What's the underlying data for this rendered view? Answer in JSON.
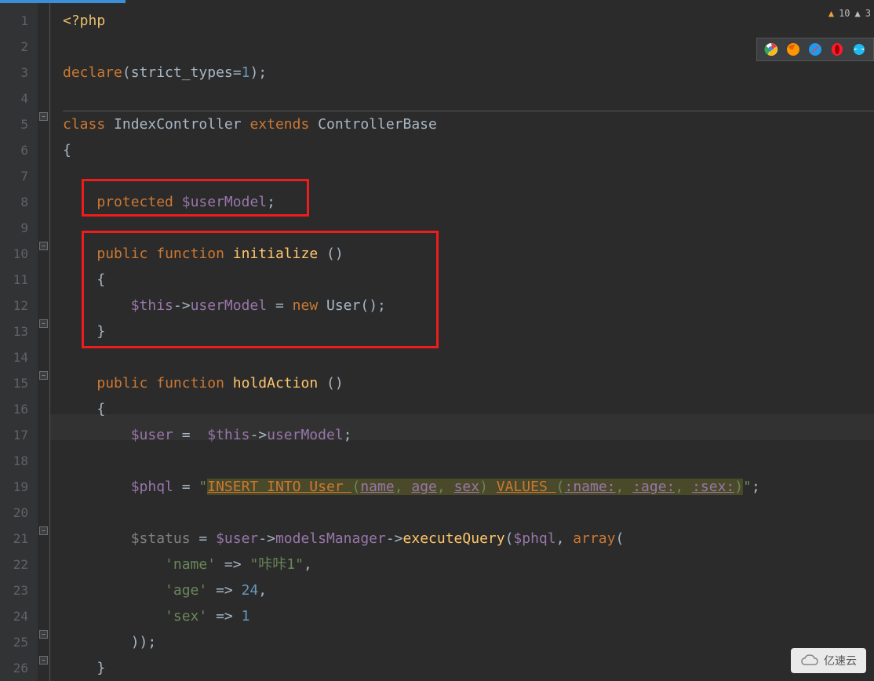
{
  "warnings": {
    "warn_count": "10",
    "err_count": "3"
  },
  "browsers": [
    "chrome",
    "firefox",
    "safari",
    "opera",
    "ie"
  ],
  "watermark": "亿速云",
  "gutter": [
    "1",
    "2",
    "3",
    "4",
    "5",
    "6",
    "7",
    "8",
    "9",
    "10",
    "11",
    "12",
    "13",
    "14",
    "15",
    "16",
    "17",
    "18",
    "19",
    "20",
    "21",
    "22",
    "23",
    "24",
    "25",
    "26"
  ],
  "code": {
    "l1": {
      "open": "<?php"
    },
    "l3": {
      "declare": "declare",
      "p1": "(",
      "strict": "strict_types",
      "eq": "=",
      "one": "1",
      "p2": ")",
      "semi": ";"
    },
    "l5": {
      "class": "class",
      "name": "IndexController",
      "extends": "extends",
      "base": "ControllerBase"
    },
    "l6": {
      "brace": "{"
    },
    "l8": {
      "protected": "protected",
      "var": "$userModel",
      "semi": ";"
    },
    "l10": {
      "public": "public",
      "function": "function",
      "name": "initialize",
      "parens": "()"
    },
    "l11": {
      "brace": "{"
    },
    "l12": {
      "thisv": "$this",
      "arrow": "->",
      "prop": "userModel",
      "eq": " = ",
      "new": "new",
      "cls": "User",
      "end": "();"
    },
    "l13": {
      "brace": "}"
    },
    "l15": {
      "public": "public",
      "function": "function",
      "name": "holdAction",
      "parens": "()"
    },
    "l16": {
      "brace": "{"
    },
    "l17": {
      "user": "$user",
      "eq": " =  ",
      "thisv": "$this",
      "arrow": "->",
      "prop": "userModel",
      "semi": ";"
    },
    "l19": {
      "phql": "$phql",
      "eq": " = ",
      "q1": "\"",
      "insert": "INSERT INTO User ",
      "p1": "(",
      "name": "name",
      "c1": ", ",
      "age": "age",
      "c2": ", ",
      "sex": "sex",
      "p2": ") ",
      "values": "VALUES ",
      "p3": "(",
      "bname": ":name:",
      "c3": ", ",
      "bage": ":age:",
      "c4": ", ",
      "bsex": ":sex:",
      "p4": ")",
      "q2": "\"",
      "semi": ";"
    },
    "l21": {
      "status": "$status",
      "eq": " = ",
      "user": "$user",
      "arrow1": "->",
      "mm": "modelsManager",
      "arrow2": "->",
      "exec": "executeQuery",
      "p1": "(",
      "phql": "$phql",
      "c": ", ",
      "array": "array",
      "p2": "("
    },
    "l22": {
      "key": "'name'",
      "arrow": " => ",
      "val": "\"咔咔1\"",
      "c": ","
    },
    "l23": {
      "key": "'age'",
      "arrow": " => ",
      "val": "24",
      "c": ","
    },
    "l24": {
      "key": "'sex'",
      "arrow": " => ",
      "val": "1"
    },
    "l25": {
      "close": "));"
    },
    "l26": {
      "brace": "}"
    }
  }
}
